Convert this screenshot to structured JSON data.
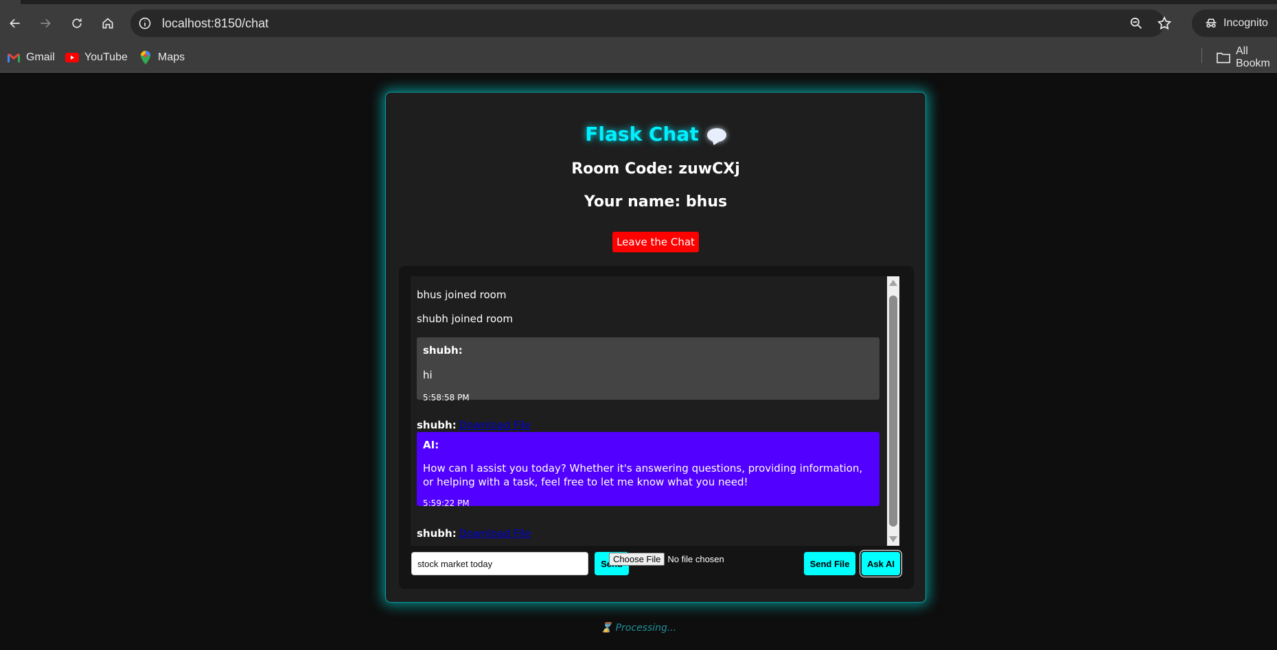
{
  "browser": {
    "url": "localhost:8150/chat",
    "profile_label": "Incognito",
    "bookmarks": [
      {
        "label": "Gmail"
      },
      {
        "label": "YouTube"
      },
      {
        "label": "Maps"
      }
    ],
    "all_bookmarks_label": "All Bookm"
  },
  "page": {
    "title": "Flask Chat",
    "room_code": "Room Code: zuwCXj",
    "your_name": "Your name: bhus",
    "leave_label": "Leave the Chat",
    "processing_text": "Processing..."
  },
  "messages": {
    "system": [
      "bhus joined room",
      "shubh joined room"
    ],
    "chat": [
      {
        "sender": "shubh:",
        "text": "hi",
        "time": "5:58:58 PM"
      },
      {
        "sender": "AI:",
        "text": "How can I assist you today? Whether it's answering questions, providing information, or helping with a task, feel free to let me know what you need!",
        "time": "5:59:22 PM"
      }
    ],
    "files": [
      {
        "sender": "shubh:",
        "link": "Download File"
      },
      {
        "sender": "shubh:",
        "link": "Download File"
      }
    ]
  },
  "controls": {
    "message_value": "stock market today",
    "send_label": "Send",
    "choose_file_label": "Choose File",
    "no_file_text": "No file chosen",
    "send_file_label": "Send File",
    "ask_ai_label": "Ask AI"
  },
  "colors": {
    "accent": "#00f0ff",
    "leave": "#ff0000",
    "ai_bubble": "#5200ff",
    "user_bubble": "#444444"
  }
}
